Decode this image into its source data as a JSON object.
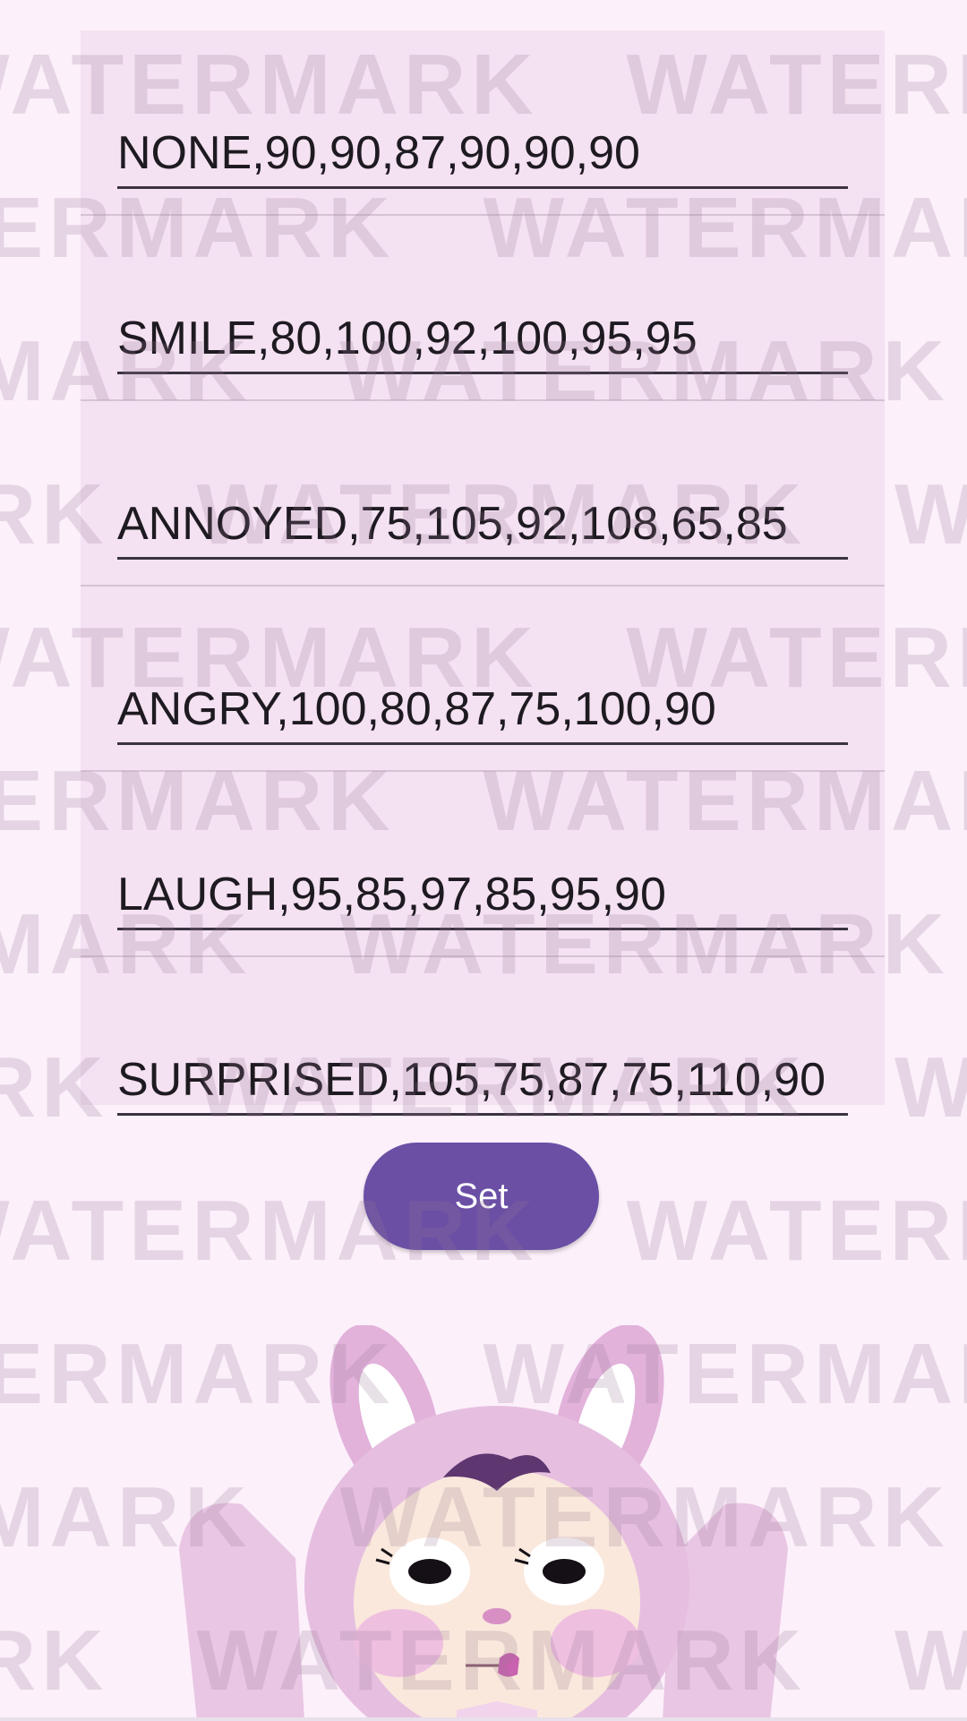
{
  "expressions": [
    {
      "value": "NONE,90,90,87,90,90,90"
    },
    {
      "value": "SMILE,80,100,92,100,95,95"
    },
    {
      "value": "ANNOYED,75,105,92,108,65,85"
    },
    {
      "value": "ANGRY,100,80,87,75,100,90"
    },
    {
      "value": "LAUGH,95,85,97,85,95,90"
    },
    {
      "value": "SURPRISED,105,75,87,75,110,90"
    }
  ],
  "set_button": {
    "label": "Set"
  },
  "watermark": {
    "text": "WATERMARK"
  },
  "colors": {
    "background": "#fcf0fb",
    "panel": "#f4e1f1",
    "button": "#6a4fa5",
    "button_text": "#ffffff",
    "underline": "#3a3340"
  },
  "icons": {
    "mascot": "bunny-hood-character-icon"
  }
}
